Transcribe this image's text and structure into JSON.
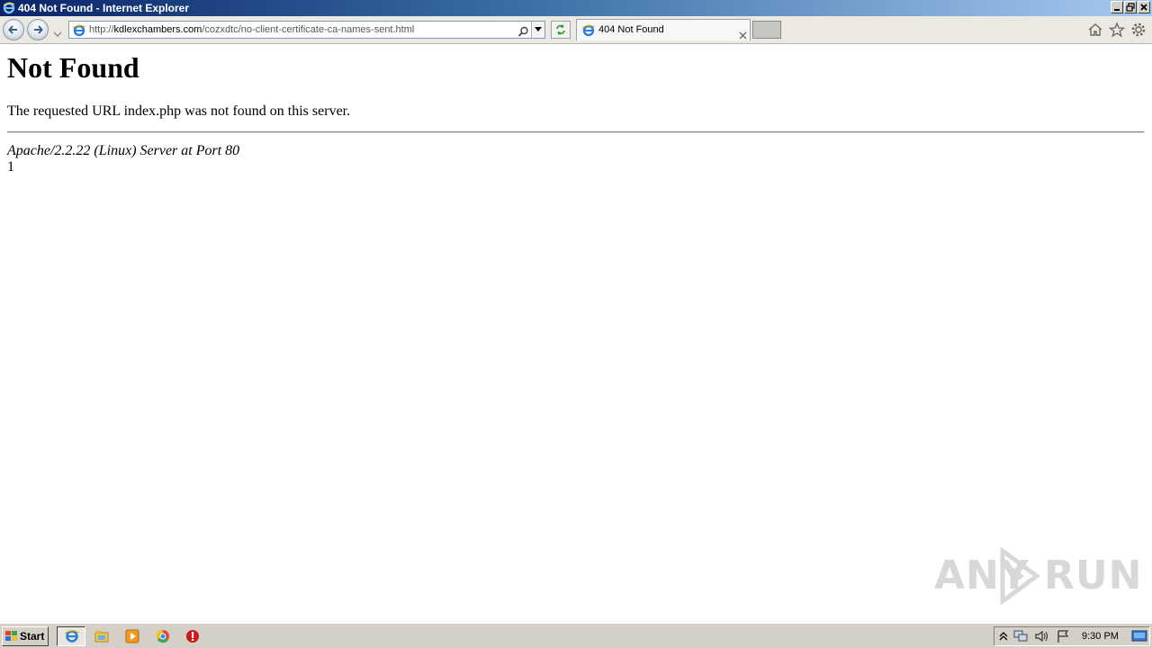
{
  "window": {
    "title": "404 Not Found - Internet Explorer"
  },
  "navbar": {
    "url_prefix": "http://",
    "url_host": "kdlexchambers.com",
    "url_path": "/cozxdtc/no-client-certificate-ca-names-sent.html",
    "tab_label": "404 Not Found"
  },
  "page": {
    "heading": "Not Found",
    "message": "The requested URL index.php was not found on this server.",
    "server_signature": "Apache/2.2.22 (Linux) Server at Port 80",
    "extra": "1"
  },
  "watermark": {
    "left": "ANY",
    "right": "RUN"
  },
  "taskbar": {
    "start_label": "Start",
    "clock": "9:30 PM"
  },
  "icons": {
    "browser": "ie-icon",
    "back": "back-arrow-icon",
    "forward": "forward-arrow-icon",
    "search": "search-icon",
    "refresh": "refresh-icon",
    "close": "close-icon",
    "home": "home-icon",
    "favorites": "star-icon",
    "tools": "gear-icon"
  },
  "colors": {
    "titlebar_start": "#0a246a",
    "titlebar_end": "#a6caf0",
    "taskbar": "#d4d0c8",
    "watermark": "#d8d8d8"
  }
}
